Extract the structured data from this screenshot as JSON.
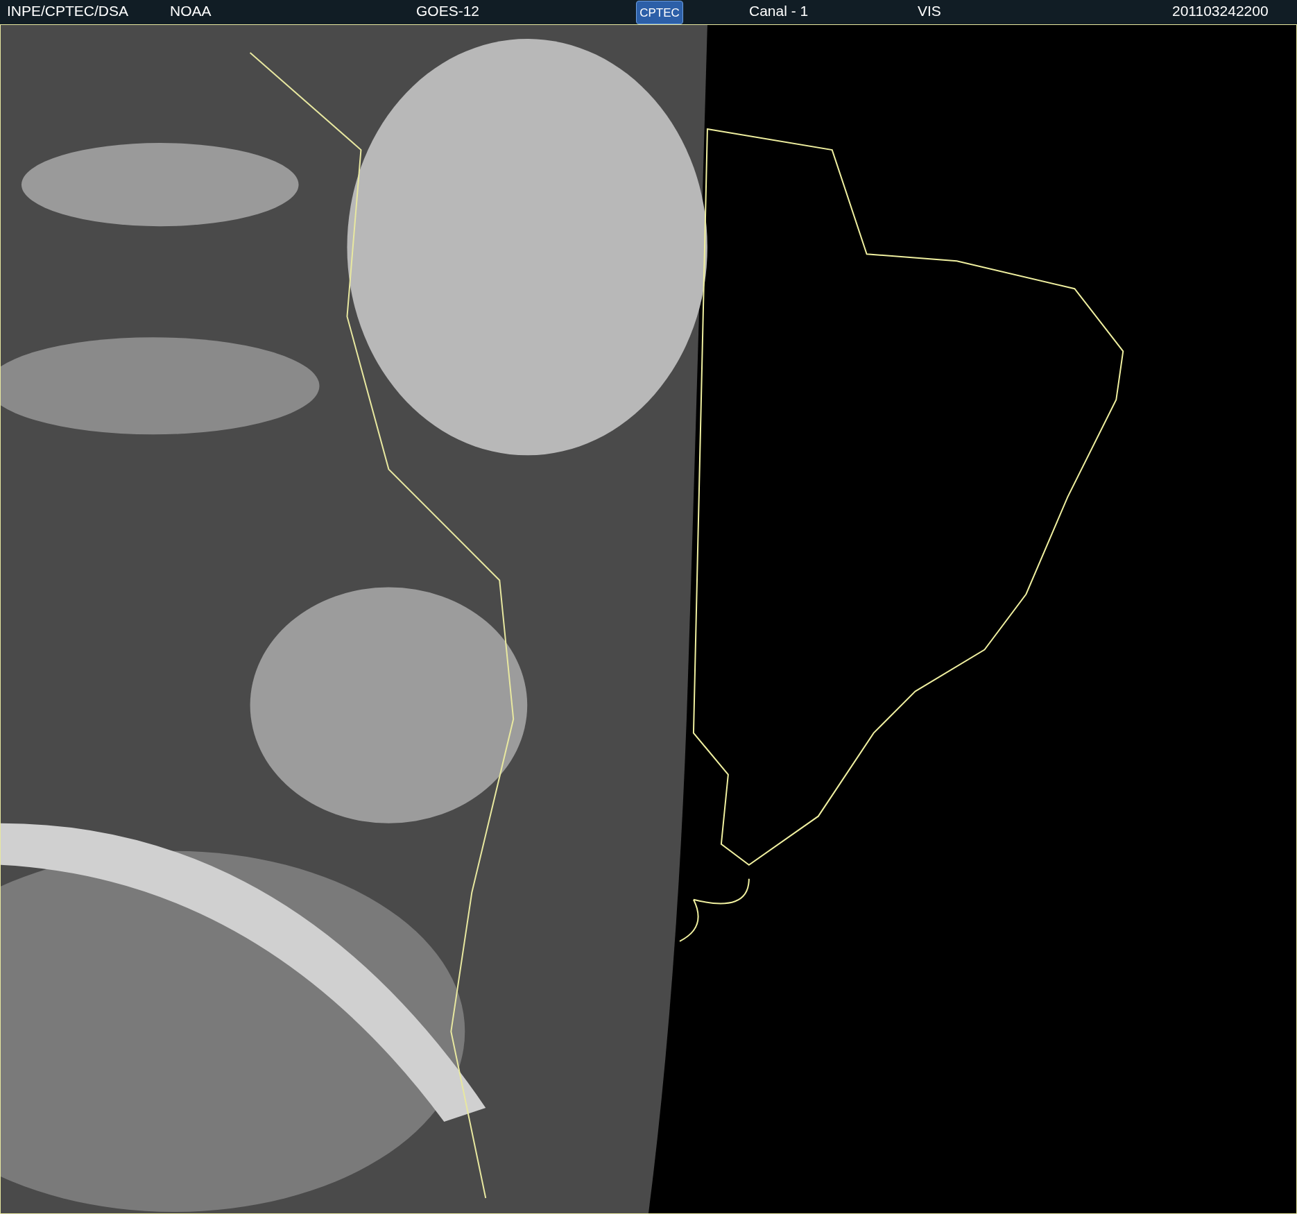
{
  "header": {
    "items": [
      {
        "kind": "text",
        "text": "INPE/CPTEC/DSA"
      },
      {
        "kind": "text",
        "text": "NOAA"
      },
      {
        "kind": "text",
        "text": "GOES-12"
      },
      {
        "kind": "logo",
        "text": "CPTEC"
      },
      {
        "kind": "text",
        "text": "Canal - 1"
      },
      {
        "kind": "text",
        "text": "VIS"
      },
      {
        "kind": "text",
        "text": "201103242200"
      }
    ]
  }
}
